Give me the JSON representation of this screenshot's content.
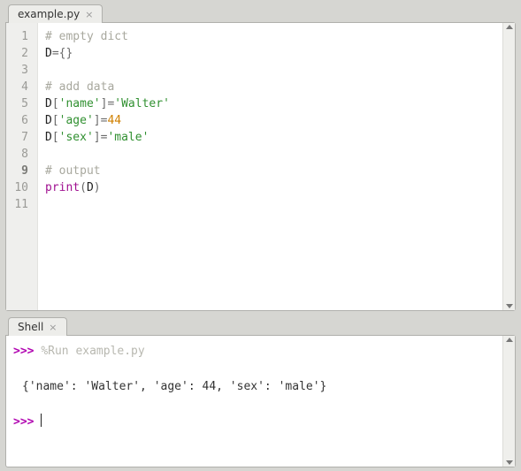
{
  "editor": {
    "tab_label": "example.py",
    "line_numbers": [
      "1",
      "2",
      "3",
      "4",
      "5",
      "6",
      "7",
      "8",
      "9",
      "10",
      "11"
    ],
    "bold_line": "9",
    "code": {
      "l1_comment": "# empty dict",
      "l2_var": "D",
      "l2_eq": "=",
      "l2_open": "{",
      "l2_close": "}",
      "l4_comment": "# add data",
      "l5_var": "D",
      "l5_lb": "[",
      "l5_key": "'name'",
      "l5_rb": "]",
      "l5_eq": "=",
      "l5_val": "'Walter'",
      "l6_var": "D",
      "l6_lb": "[",
      "l6_key": "'age'",
      "l6_rb": "]",
      "l6_eq": "=",
      "l6_val": "44",
      "l7_var": "D",
      "l7_lb": "[",
      "l7_key": "'sex'",
      "l7_rb": "]",
      "l7_eq": "=",
      "l7_val": "'male'",
      "l9_comment": "# output",
      "l10_func": "print",
      "l10_lp": "(",
      "l10_arg": "D",
      "l10_rp": ")"
    }
  },
  "shell": {
    "tab_label": "Shell",
    "prompt": ">>>",
    "run_cmd": "%Run example.py",
    "output": "{'name': 'Walter', 'age': 44, 'sex': 'male'}"
  }
}
